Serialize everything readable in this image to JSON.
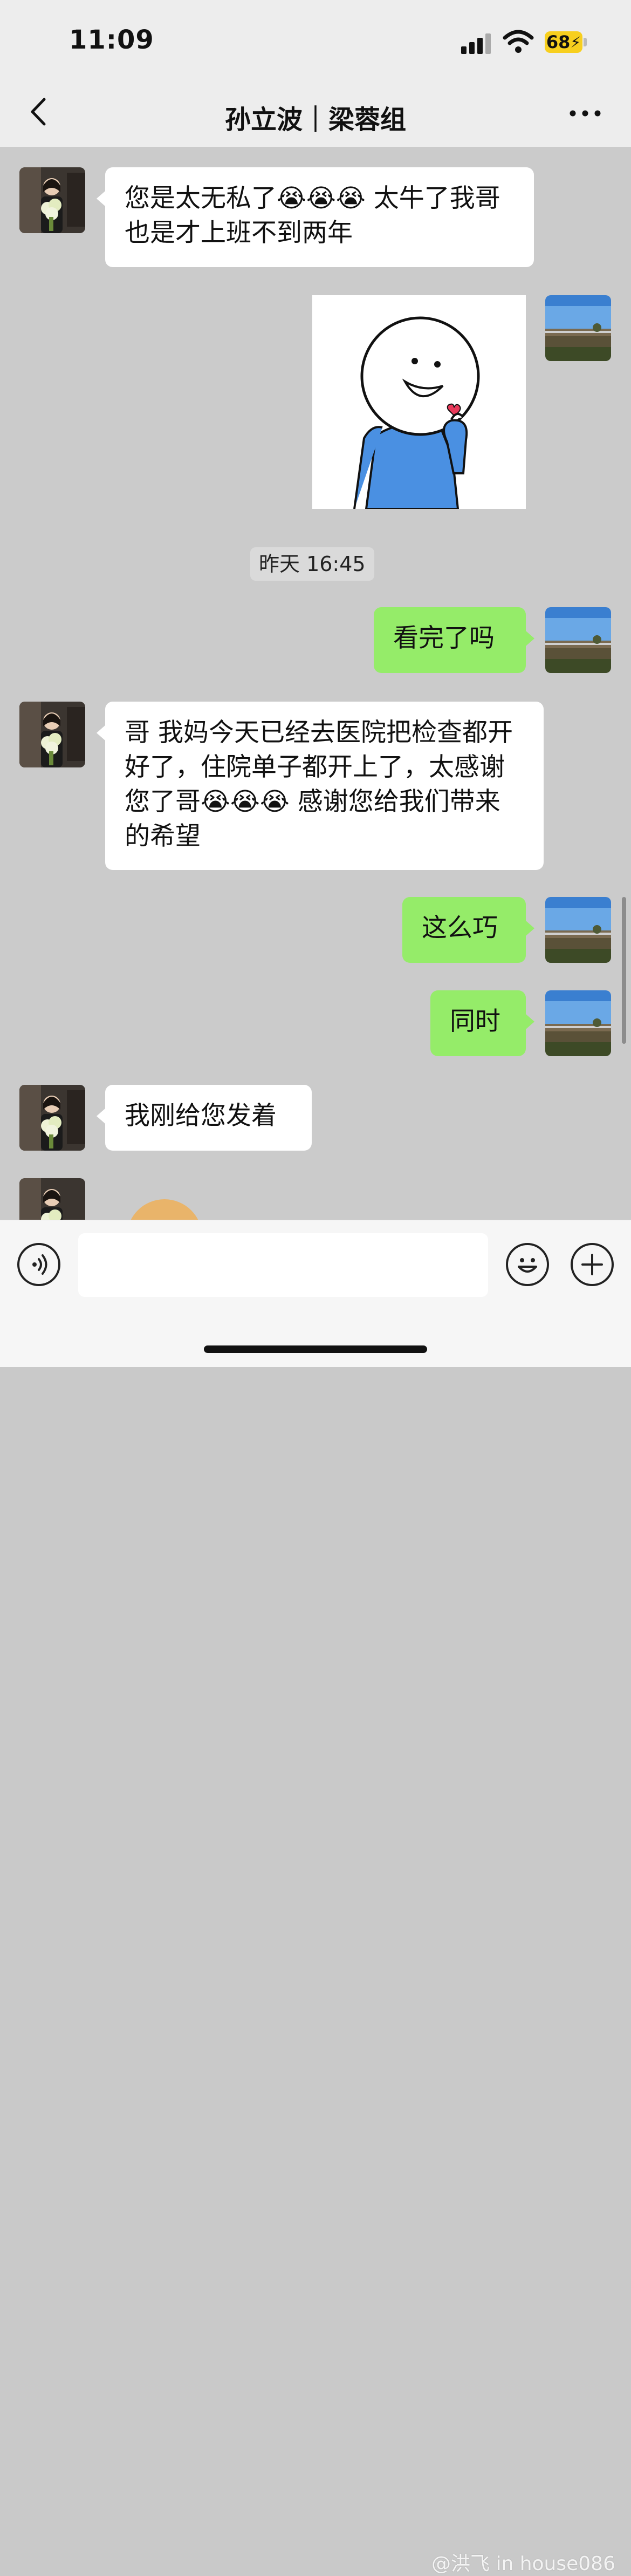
{
  "status_bar": {
    "time": "11:09",
    "battery": "68"
  },
  "header": {
    "title": "孙立波｜梁蓉组"
  },
  "messages": [
    {
      "side": "left",
      "text": "您是太无私了😭😭😭 太牛了我哥也是才上班不到两年"
    },
    {
      "side": "right",
      "type": "sticker",
      "icon": "thumb-heart-stick-figure"
    },
    {
      "type": "timestamp",
      "text": "昨天 16:45"
    },
    {
      "side": "right",
      "text": "看完了吗"
    },
    {
      "side": "left",
      "text": "哥 我妈今天已经去医院把检查都开好了，住院单子都开上了，太感谢您了哥😭😭😭 感谢您给我们带来的希望"
    },
    {
      "side": "right",
      "text": "这么巧"
    },
    {
      "side": "right",
      "text": "同时"
    },
    {
      "side": "left",
      "text": "我刚给您发着"
    }
  ],
  "input_bar": {
    "placeholder": ""
  },
  "watermark": "@洪飞 in house086",
  "colors": {
    "right_bubble": "#95ec69",
    "left_bubble": "#ffffff",
    "chat_bg": "#cbcbcb"
  }
}
